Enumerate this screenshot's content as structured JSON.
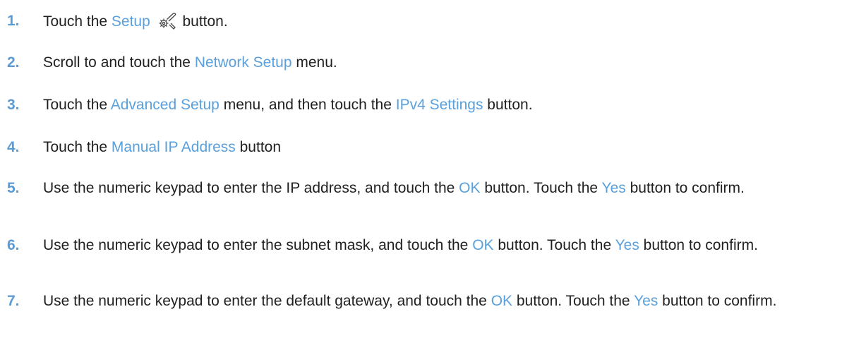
{
  "colors": {
    "step_number": "#5b9bd5",
    "ui_term": "#5aa0dc",
    "text": "#1f1f1f"
  },
  "steps": [
    {
      "number": "1.",
      "parts": [
        "Touch the ",
        "Setup",
        " button."
      ],
      "icon": "setup-wrench-gear-icon"
    },
    {
      "number": "2.",
      "parts": [
        "Scroll to and touch the ",
        "Network Setup",
        " menu."
      ]
    },
    {
      "number": "3.",
      "parts": [
        "Touch the ",
        "Advanced Setup",
        " menu, and then touch the ",
        "IPv4 Settings",
        " button."
      ]
    },
    {
      "number": "4.",
      "parts": [
        "Touch the ",
        "Manual IP Address",
        " button"
      ]
    },
    {
      "number": "5.",
      "parts": [
        "Use the numeric keypad to enter the IP address, and touch the ",
        "OK",
        " button. Touch the ",
        "Yes",
        " button to confirm."
      ]
    },
    {
      "number": "6.",
      "parts": [
        "Use the numeric keypad to enter the subnet mask, and touch the ",
        "OK",
        " button. Touch the ",
        "Yes",
        " button to confirm."
      ]
    },
    {
      "number": "7.",
      "parts": [
        "Use the numeric keypad to enter the default gateway, and touch the ",
        "OK",
        " button. Touch the ",
        "Yes",
        " button to confirm."
      ]
    }
  ]
}
